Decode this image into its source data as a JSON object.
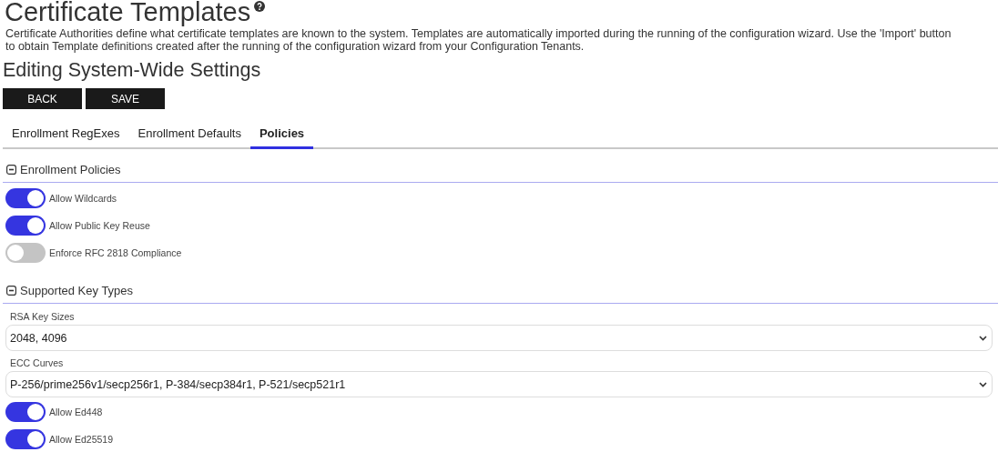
{
  "title": "Certificate Templates",
  "description": "Certificate Authorities define what certificate templates are known to the system. Templates are automatically imported during the running of the configuration wizard. Use the 'Import' button to obtain Template definitions created after the running of the configuration wizard from your Configuration Tenants.",
  "subtitle": "Editing System-Wide Settings",
  "buttons": [
    "BACK",
    "SAVE"
  ],
  "tabs": [
    {
      "label": "Enrollment RegExes",
      "selected": false
    },
    {
      "label": "Enrollment Defaults",
      "selected": false
    },
    {
      "label": "Policies",
      "selected": true
    }
  ],
  "sections": [
    {
      "title": "Enrollment Policies",
      "expanded": true,
      "items": [
        {
          "kind": "toggle",
          "label": "Allow Wildcards",
          "on": true
        },
        {
          "kind": "toggle",
          "label": "Allow Public Key Reuse",
          "on": true
        },
        {
          "kind": "toggle",
          "label": "Enforce RFC 2818 Compliance",
          "on": false
        }
      ]
    },
    {
      "title": "Supported Key Types",
      "expanded": true,
      "items": [
        {
          "kind": "select",
          "label": "RSA Key Sizes",
          "value": "2048, 4096"
        },
        {
          "kind": "select",
          "label": "ECC Curves",
          "value": "P-256/prime256v1/secp256r1, P-384/secp384r1, P-521/secp521r1"
        },
        {
          "kind": "toggle",
          "label": "Allow Ed448",
          "on": true
        },
        {
          "kind": "toggle",
          "label": "Allow Ed25519",
          "on": true
        }
      ]
    }
  ]
}
